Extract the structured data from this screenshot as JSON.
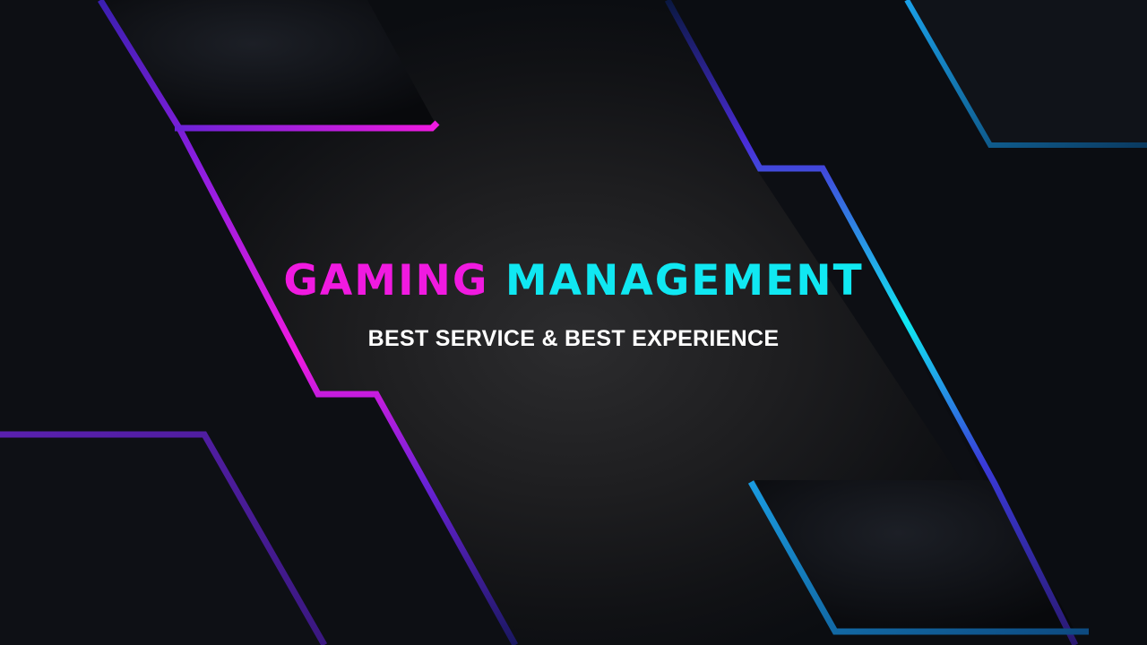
{
  "banner": {
    "title_part1": "GAMING",
    "title_part2": "MANAGEMENT",
    "subtitle": "BEST SERVICE & BEST EXPERIENCE"
  },
  "colors": {
    "background": "#0b0d11",
    "accent_magenta": "#f01ae0",
    "accent_cyan": "#10e8f2",
    "accent_purple": "#5a2fd6",
    "accent_blue": "#1a9be0",
    "text": "#ffffff"
  }
}
